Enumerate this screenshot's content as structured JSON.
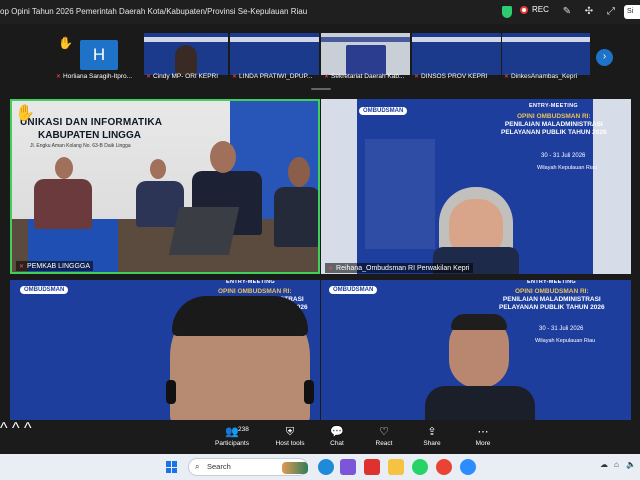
{
  "window": {
    "title": "op Opini Tahun 2026 Pemerintah Daerah Kota/Kabupaten/Provinsi Se-Kepulauan Riau",
    "rec_label": "REC",
    "sign_out_label": "Si"
  },
  "strip": {
    "avatar_letter": "H",
    "participants": [
      "Horliana Saragih-Itpro...",
      "Cindy MP- ORI KEPRI",
      "LINDA PRATIWI_DPUP...",
      "Sekretariat Daerah Kab...",
      "DINSOS PROV KEPRI",
      "DinkesAnambas_Kepri"
    ]
  },
  "tiles": {
    "a": {
      "label": "PEMKAB LINGGGA",
      "sign_line1": "UNIKASI DAN INFORMATIKA",
      "sign_line2": "KABUPATEN LINGGA",
      "sign_line3": "Jl. Engku Aman Kolang No. 63-B Daik Lingga"
    },
    "b": {
      "label": "Reihana_Ombudsman RI Perwakilan Kepri"
    },
    "slide": {
      "org": "OMBUDSMAN",
      "entry": "ENTRY-MEETING",
      "line1": "OPINI OMBUDSMAN RI:",
      "line2": "PENILAIAN MALADMINISTRASI",
      "line3": "PELAYANAN PUBLIK TAHUN 2026",
      "date": "30 - 31 Juli 2026",
      "region": "Wilayah Kepulauan Riau"
    }
  },
  "toolbar": {
    "participants_label": "Participants",
    "participants_count": "238",
    "host_tools_label": "Host tools",
    "chat_label": "Chat",
    "react_label": "React",
    "share_label": "Share",
    "more_label": "More"
  },
  "taskbar": {
    "search_placeholder": "Search"
  }
}
